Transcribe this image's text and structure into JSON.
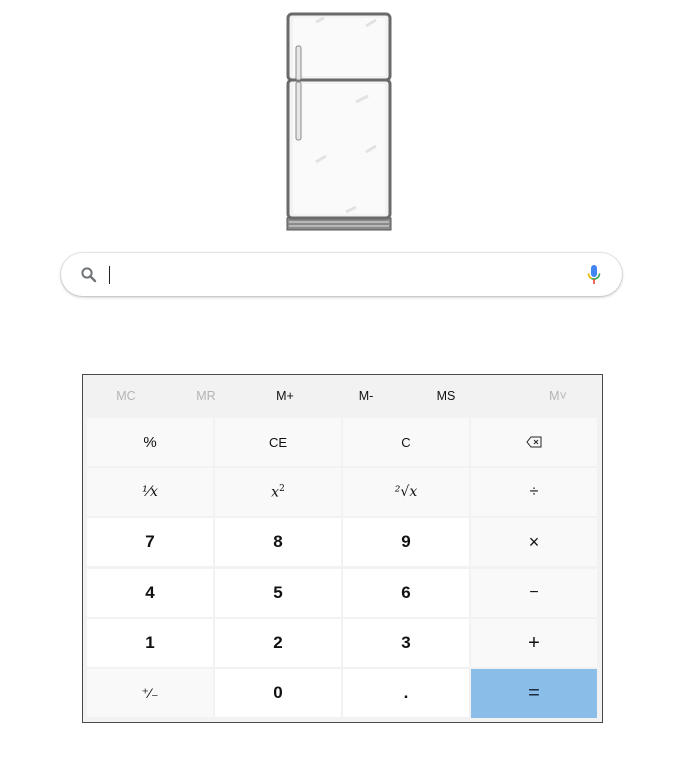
{
  "search": {
    "value": "",
    "placeholder": ""
  },
  "memory": [
    {
      "label": "MC",
      "enabled": false
    },
    {
      "label": "MR",
      "enabled": false
    },
    {
      "label": "M+",
      "enabled": true
    },
    {
      "label": "M-",
      "enabled": true
    },
    {
      "label": "MS",
      "enabled": true
    },
    {
      "label": "M˅",
      "enabled": false
    }
  ],
  "keys": {
    "percent": "%",
    "clear_entry": "CE",
    "clear": "C",
    "backspace_icon": "backspace-icon",
    "reciprocal": "¹⁄x",
    "square": "x",
    "square_sup": "2",
    "sqrt": "²√x",
    "divide": "÷",
    "seven": "7",
    "eight": "8",
    "nine": "9",
    "multiply": "×",
    "four": "4",
    "five": "5",
    "six": "6",
    "minus": "−",
    "one": "1",
    "two": "2",
    "three": "3",
    "plus": "+",
    "negate": "⁺⁄₋",
    "zero": "0",
    "decimal": ".",
    "equals": "="
  },
  "colors": {
    "equals_key": "#8abde8",
    "function_key": "#f9f9f9",
    "number_key": "#ffffff",
    "mic_blue": "#4285f4",
    "mic_red": "#ea4335"
  }
}
